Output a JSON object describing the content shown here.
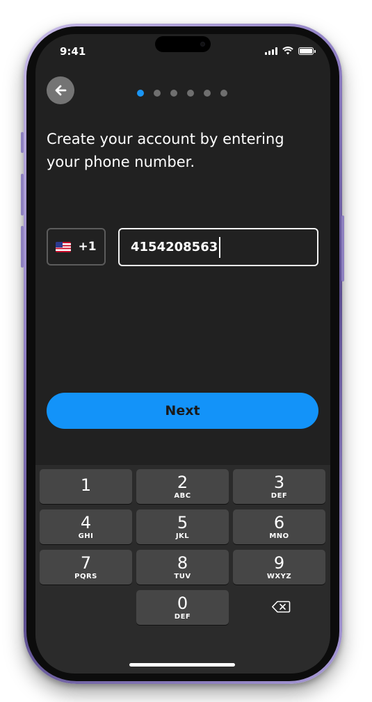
{
  "status_bar": {
    "time": "9:41"
  },
  "progress": {
    "total_steps": 6,
    "current_step": 1
  },
  "heading": "Create your account by entering your phone number.",
  "country": {
    "code": "+1",
    "flag": "us-flag"
  },
  "phone_input": {
    "value": "4154208563"
  },
  "next_button": {
    "label": "Next"
  },
  "keypad": {
    "keys": [
      {
        "num": "1",
        "letters": ""
      },
      {
        "num": "2",
        "letters": "ABC"
      },
      {
        "num": "3",
        "letters": "DEF"
      },
      {
        "num": "4",
        "letters": "GHI"
      },
      {
        "num": "5",
        "letters": "JKL"
      },
      {
        "num": "6",
        "letters": "MNO"
      },
      {
        "num": "7",
        "letters": "PQRS"
      },
      {
        "num": "8",
        "letters": "TUV"
      },
      {
        "num": "9",
        "letters": "WXYZ"
      },
      {
        "num": "0",
        "letters": "DEF"
      }
    ],
    "delete_icon": "backspace-icon"
  },
  "colors": {
    "accent": "#1393f9",
    "background": "#212121",
    "keyboard": "#2b2b2b",
    "key": "#464646"
  }
}
